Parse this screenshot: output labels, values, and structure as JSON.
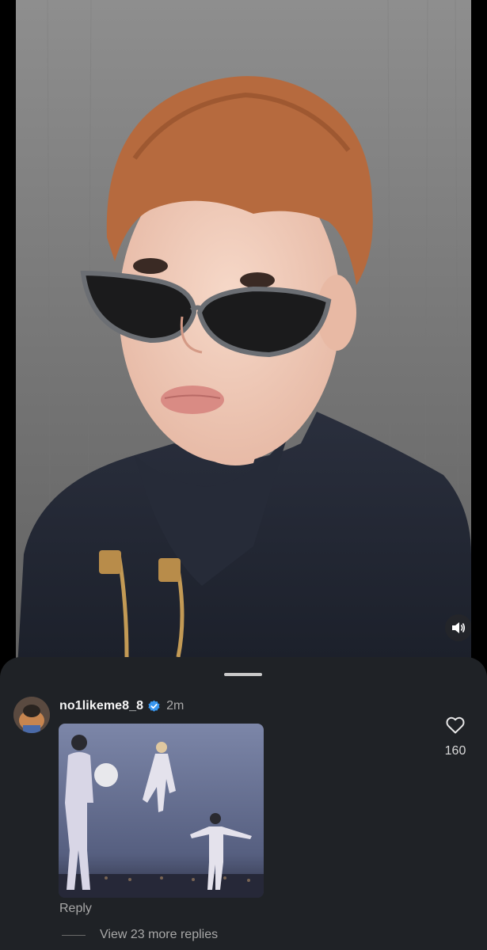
{
  "video": {
    "mute_icon": "speaker-volume-icon"
  },
  "comment": {
    "username": "no1likeme8_8",
    "verified_icon": "verified-badge-icon",
    "timestamp": "2m",
    "reply_label": "Reply",
    "view_replies_label": "View 23 more replies",
    "like_icon": "heart-outline-icon",
    "like_count": "160"
  },
  "colors": {
    "sheet_background": "#1f2226",
    "verified_blue": "#3897f0",
    "secondary_text": "#a8a8a8"
  }
}
